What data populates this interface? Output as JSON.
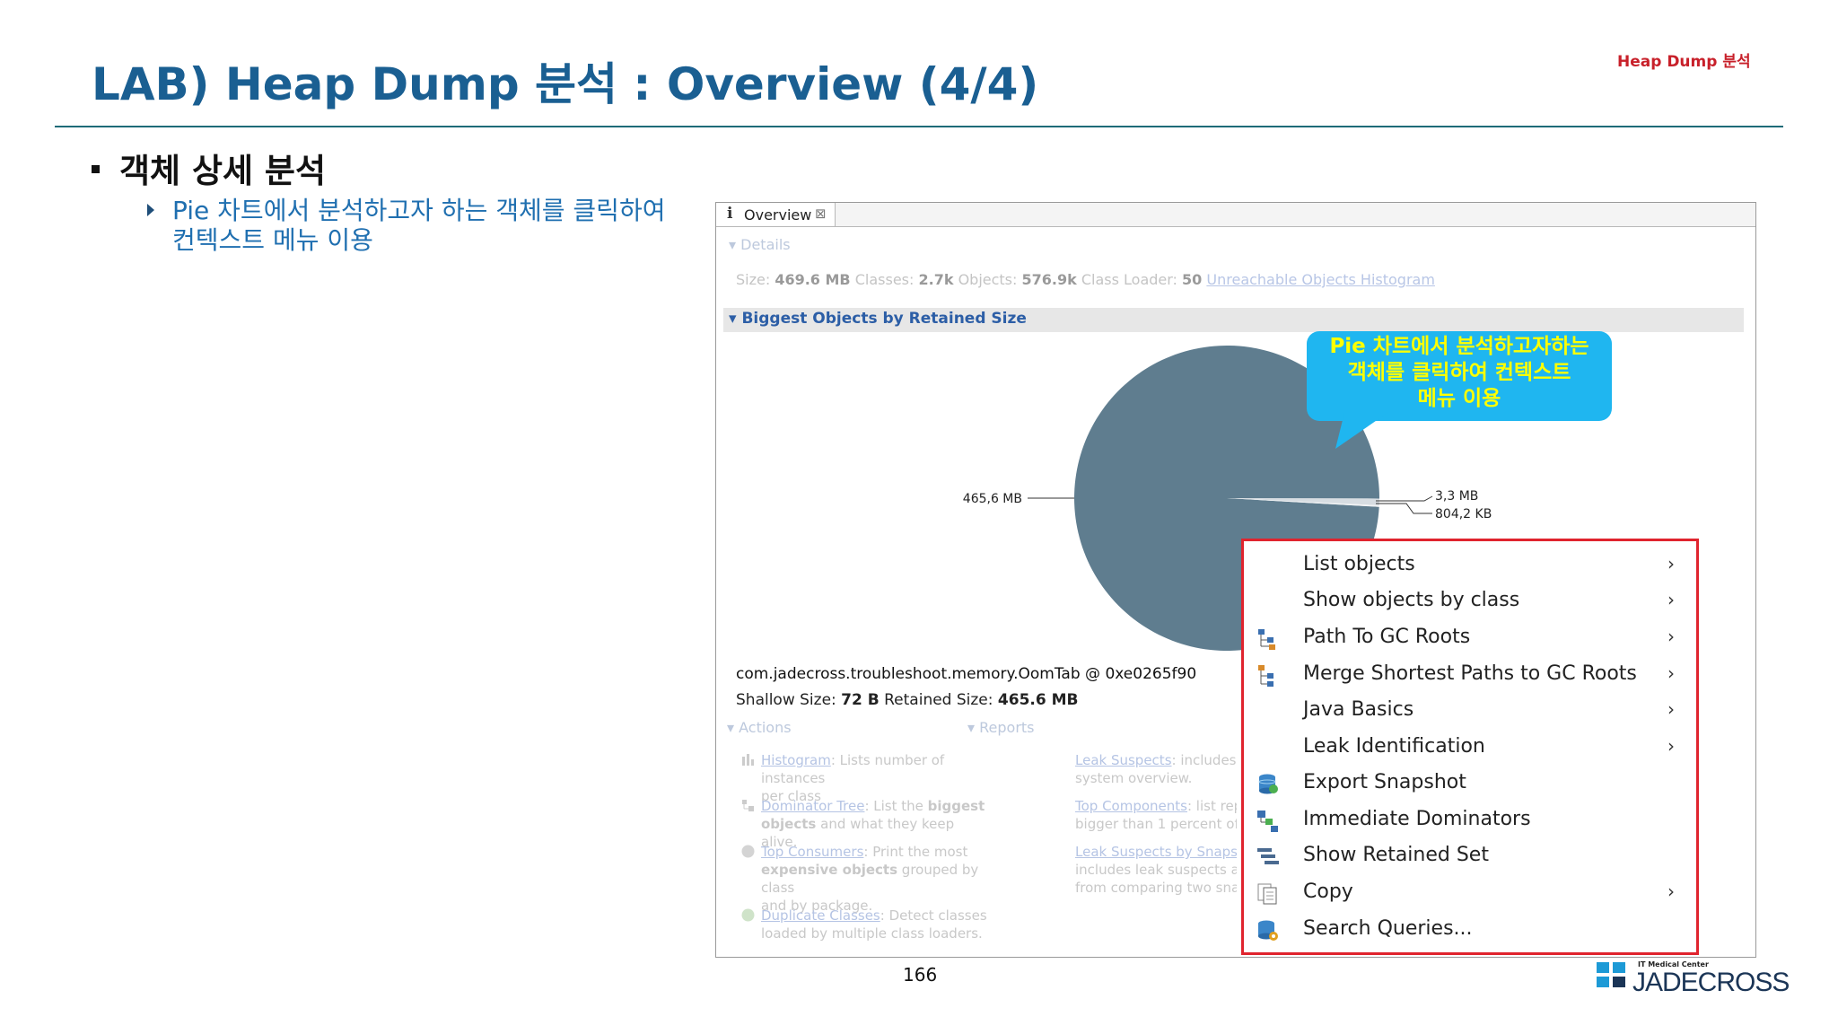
{
  "slide": {
    "title": "LAB) Heap Dump 분석 : Overview (4/4)",
    "top_label": "Heap Dump 분석",
    "bullet": "객체 상세 분석",
    "sub_bullet": "Pie 차트에서 분석하고자 하는 객체를 클릭하여 컨텍스트 메뉴 이용",
    "page_number": "166",
    "logo_small": "IT Medical Center",
    "logo_text": "JADECROSS"
  },
  "panel": {
    "tab_label": "Overview",
    "details_header": "Details",
    "details": {
      "size_label": "Size:",
      "size_value": "469.6 MB",
      "classes_label": "Classes:",
      "classes_value": "2.7k",
      "objects_label": "Objects:",
      "objects_value": "576.9k",
      "loader_label": "Class Loader:",
      "loader_value": "50",
      "link": "Unreachable Objects Histogram"
    },
    "biggest_header": "Biggest Objects by Retained Size",
    "object_name": "com.jadecross.troubleshoot.memory.OomTab @ 0xe0265f90",
    "shallow_label": "Shallow Size:",
    "shallow_value": "72 B",
    "retained_label": "Retained Size:",
    "retained_value": "465.6 MB",
    "actions_header": "Actions",
    "reports_header": "Reports",
    "actions": [
      {
        "link": "Histogram",
        "text": ": Lists number of instances",
        "text2": "per class"
      },
      {
        "link": "Dominator Tree",
        "text": ": List the ",
        "bold": "biggest",
        "text2b": "objects",
        "text2": " and what they keep alive."
      },
      {
        "link": "Top Consumers",
        "text": ": Print the most",
        "bold2": "expensive objects",
        "text2": " grouped by class",
        "text3": "and by package."
      },
      {
        "link": "Duplicate Classes",
        "text": ": Detect classes",
        "text2": "loaded by multiple class loaders."
      }
    ],
    "reports": [
      {
        "link": "Leak Suspects",
        "text": ": includes l",
        "text2": "system overview."
      },
      {
        "link": "Top Components",
        "text": ": list rep",
        "text2": "bigger than 1 percent of"
      },
      {
        "link": "Leak Suspects by Snapsh",
        "text": "",
        "text2": "includes leak suspects ar",
        "text3": "from comparing two sna"
      }
    ]
  },
  "chart_data": {
    "type": "pie",
    "values": [
      465.6,
      3.3,
      0.8
    ],
    "labels": [
      "465,6 MB",
      "3,3 MB",
      "804,2 KB"
    ],
    "unit": "MB"
  },
  "callout": {
    "line1": "Pie 차트에서 분석하고자하는",
    "line2": "객체를 클릭하여 컨텍스트",
    "line3": "메뉴 이용"
  },
  "context_menu": {
    "items": [
      {
        "label": "List objects",
        "icon": "",
        "submenu": true
      },
      {
        "label": "Show objects by class",
        "icon": "",
        "submenu": true
      },
      {
        "label": "Path To GC Roots",
        "icon": "path-tree-icon",
        "submenu": true
      },
      {
        "label": "Merge Shortest Paths to GC Roots",
        "icon": "merge-paths-icon",
        "submenu": true
      },
      {
        "label": "Java Basics",
        "icon": "",
        "submenu": true
      },
      {
        "label": "Leak Identification",
        "icon": "",
        "submenu": true
      },
      {
        "label": "Export Snapshot",
        "icon": "export-database-icon",
        "submenu": false
      },
      {
        "label": "Immediate Dominators",
        "icon": "dominators-icon",
        "submenu": false
      },
      {
        "label": "Show Retained Set",
        "icon": "retained-set-icon",
        "submenu": false
      },
      {
        "label": "Copy",
        "icon": "copy-document-icon",
        "submenu": true
      },
      {
        "label": "Search Queries...",
        "icon": "search-queries-icon",
        "submenu": false
      }
    ]
  },
  "colors": {
    "title": "#1a5f92",
    "pie_main": "#5f7d8f",
    "callout": "#1fb6f0",
    "callout_text": "#ffff00",
    "menu_border": "#e0242e"
  }
}
